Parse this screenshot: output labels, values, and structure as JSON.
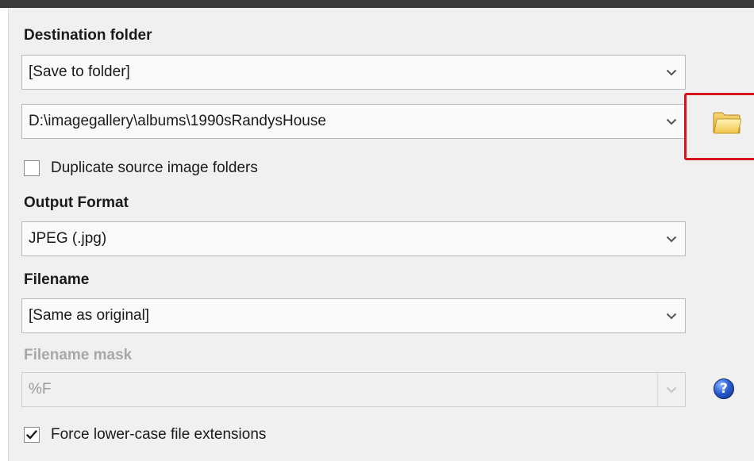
{
  "destination": {
    "label": "Destination folder",
    "mode_value": "[Save to folder]",
    "path_value": "D:\\imagegallery\\albums\\1990sRandysHouse"
  },
  "duplicate_checkbox": {
    "label": "Duplicate source image folders",
    "checked": false
  },
  "output_format": {
    "label": "Output Format",
    "value": "JPEG (.jpg)"
  },
  "filename": {
    "label": "Filename",
    "value": "[Same as original]"
  },
  "filename_mask": {
    "label": "Filename mask",
    "value": "%F",
    "disabled": true
  },
  "lowercase_checkbox": {
    "label": "Force lower-case file extensions",
    "checked": true
  },
  "help": {
    "glyph": "?"
  },
  "icons": {
    "folder": "folder-icon",
    "help": "help-icon",
    "chevron": "chevron-down-icon",
    "checkmark": "checkmark-icon"
  },
  "colors": {
    "highlight": "#d4161c",
    "panel_bg": "#f0f0f0",
    "top_bar": "#3a3a3a"
  }
}
